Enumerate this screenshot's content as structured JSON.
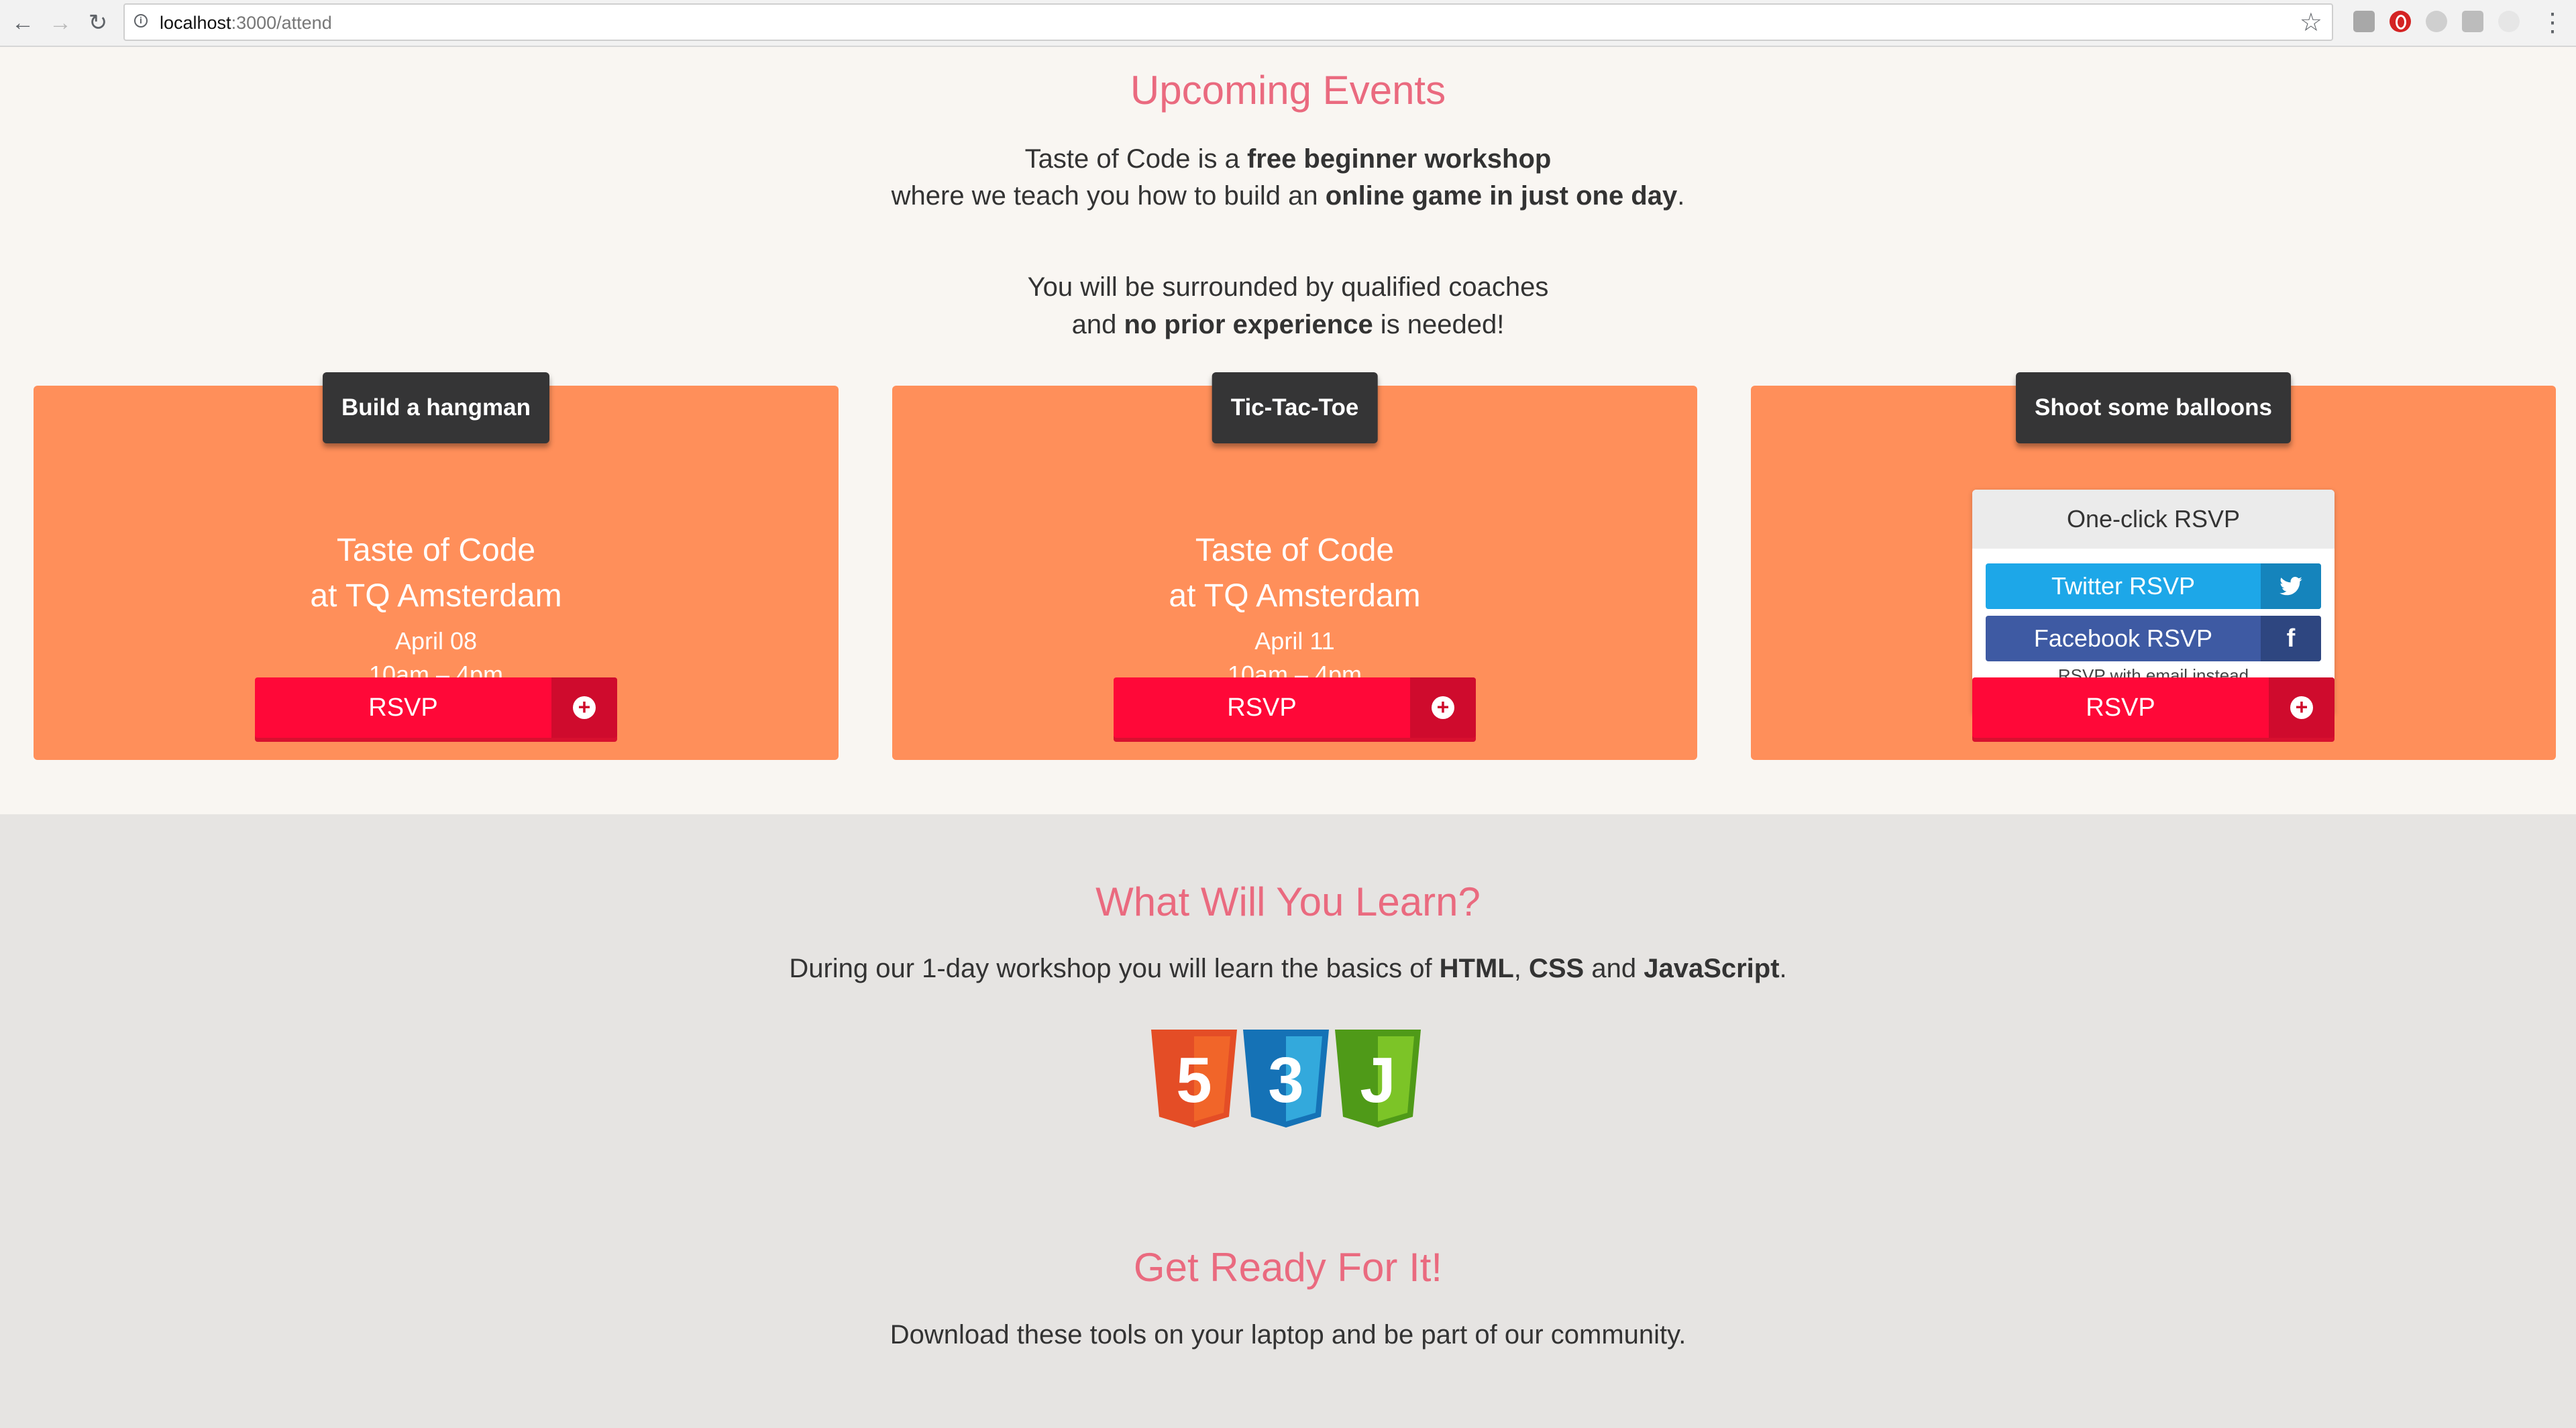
{
  "browser": {
    "url_host": "localhost",
    "url_path": ":3000/attend"
  },
  "upcoming": {
    "title": "Upcoming Events",
    "line1_a": "Taste of Code is a ",
    "line1_b": "free beginner workshop",
    "line2_a": "where we teach you how to build an ",
    "line2_b": "online game in just one day",
    "line2_c": ".",
    "line3": "You will be surrounded by qualified coaches",
    "line4_a": "and ",
    "line4_b": "no prior experience",
    "line4_c": " is needed!"
  },
  "events": [
    {
      "tag": "Build a hangman",
      "title1": "Taste of Code",
      "title2": "at TQ Amsterdam",
      "date": "April 08",
      "time": "10am – 4pm",
      "rsvp": "RSVP"
    },
    {
      "tag": "Tic-Tac-Toe",
      "title1": "Taste of Code",
      "title2": "at TQ Amsterdam",
      "date": "April 11",
      "time": "10am – 4pm",
      "rsvp": "RSVP"
    },
    {
      "tag": "Shoot some balloons",
      "rsvp": "RSVP"
    }
  ],
  "oneclick": {
    "header": "One-click RSVP",
    "twitter": "Twitter RSVP",
    "facebook": "Facebook RSVP",
    "email": "RSVP with email instead"
  },
  "learn": {
    "title": "What Will You Learn?",
    "text_a": "During our 1-day workshop you will learn the basics of ",
    "html": "HTML",
    "sep1": ", ",
    "css": "CSS",
    "sep2": " and ",
    "js": "JavaScript",
    "end": ".",
    "badges": [
      "5",
      "3",
      "J"
    ]
  },
  "ready": {
    "title": "Get Ready For It!",
    "text": "Download these tools on your laptop and be part of our community."
  },
  "colors": {
    "accent_title": "#ea6a7f",
    "card": "#ff8f5a",
    "rsvp": "#ff0838",
    "twitter": "#1da7e8",
    "facebook": "#3e5aa3",
    "html5": "#e44d26",
    "css3": "#1f7bd4",
    "js": "#58b51e"
  }
}
